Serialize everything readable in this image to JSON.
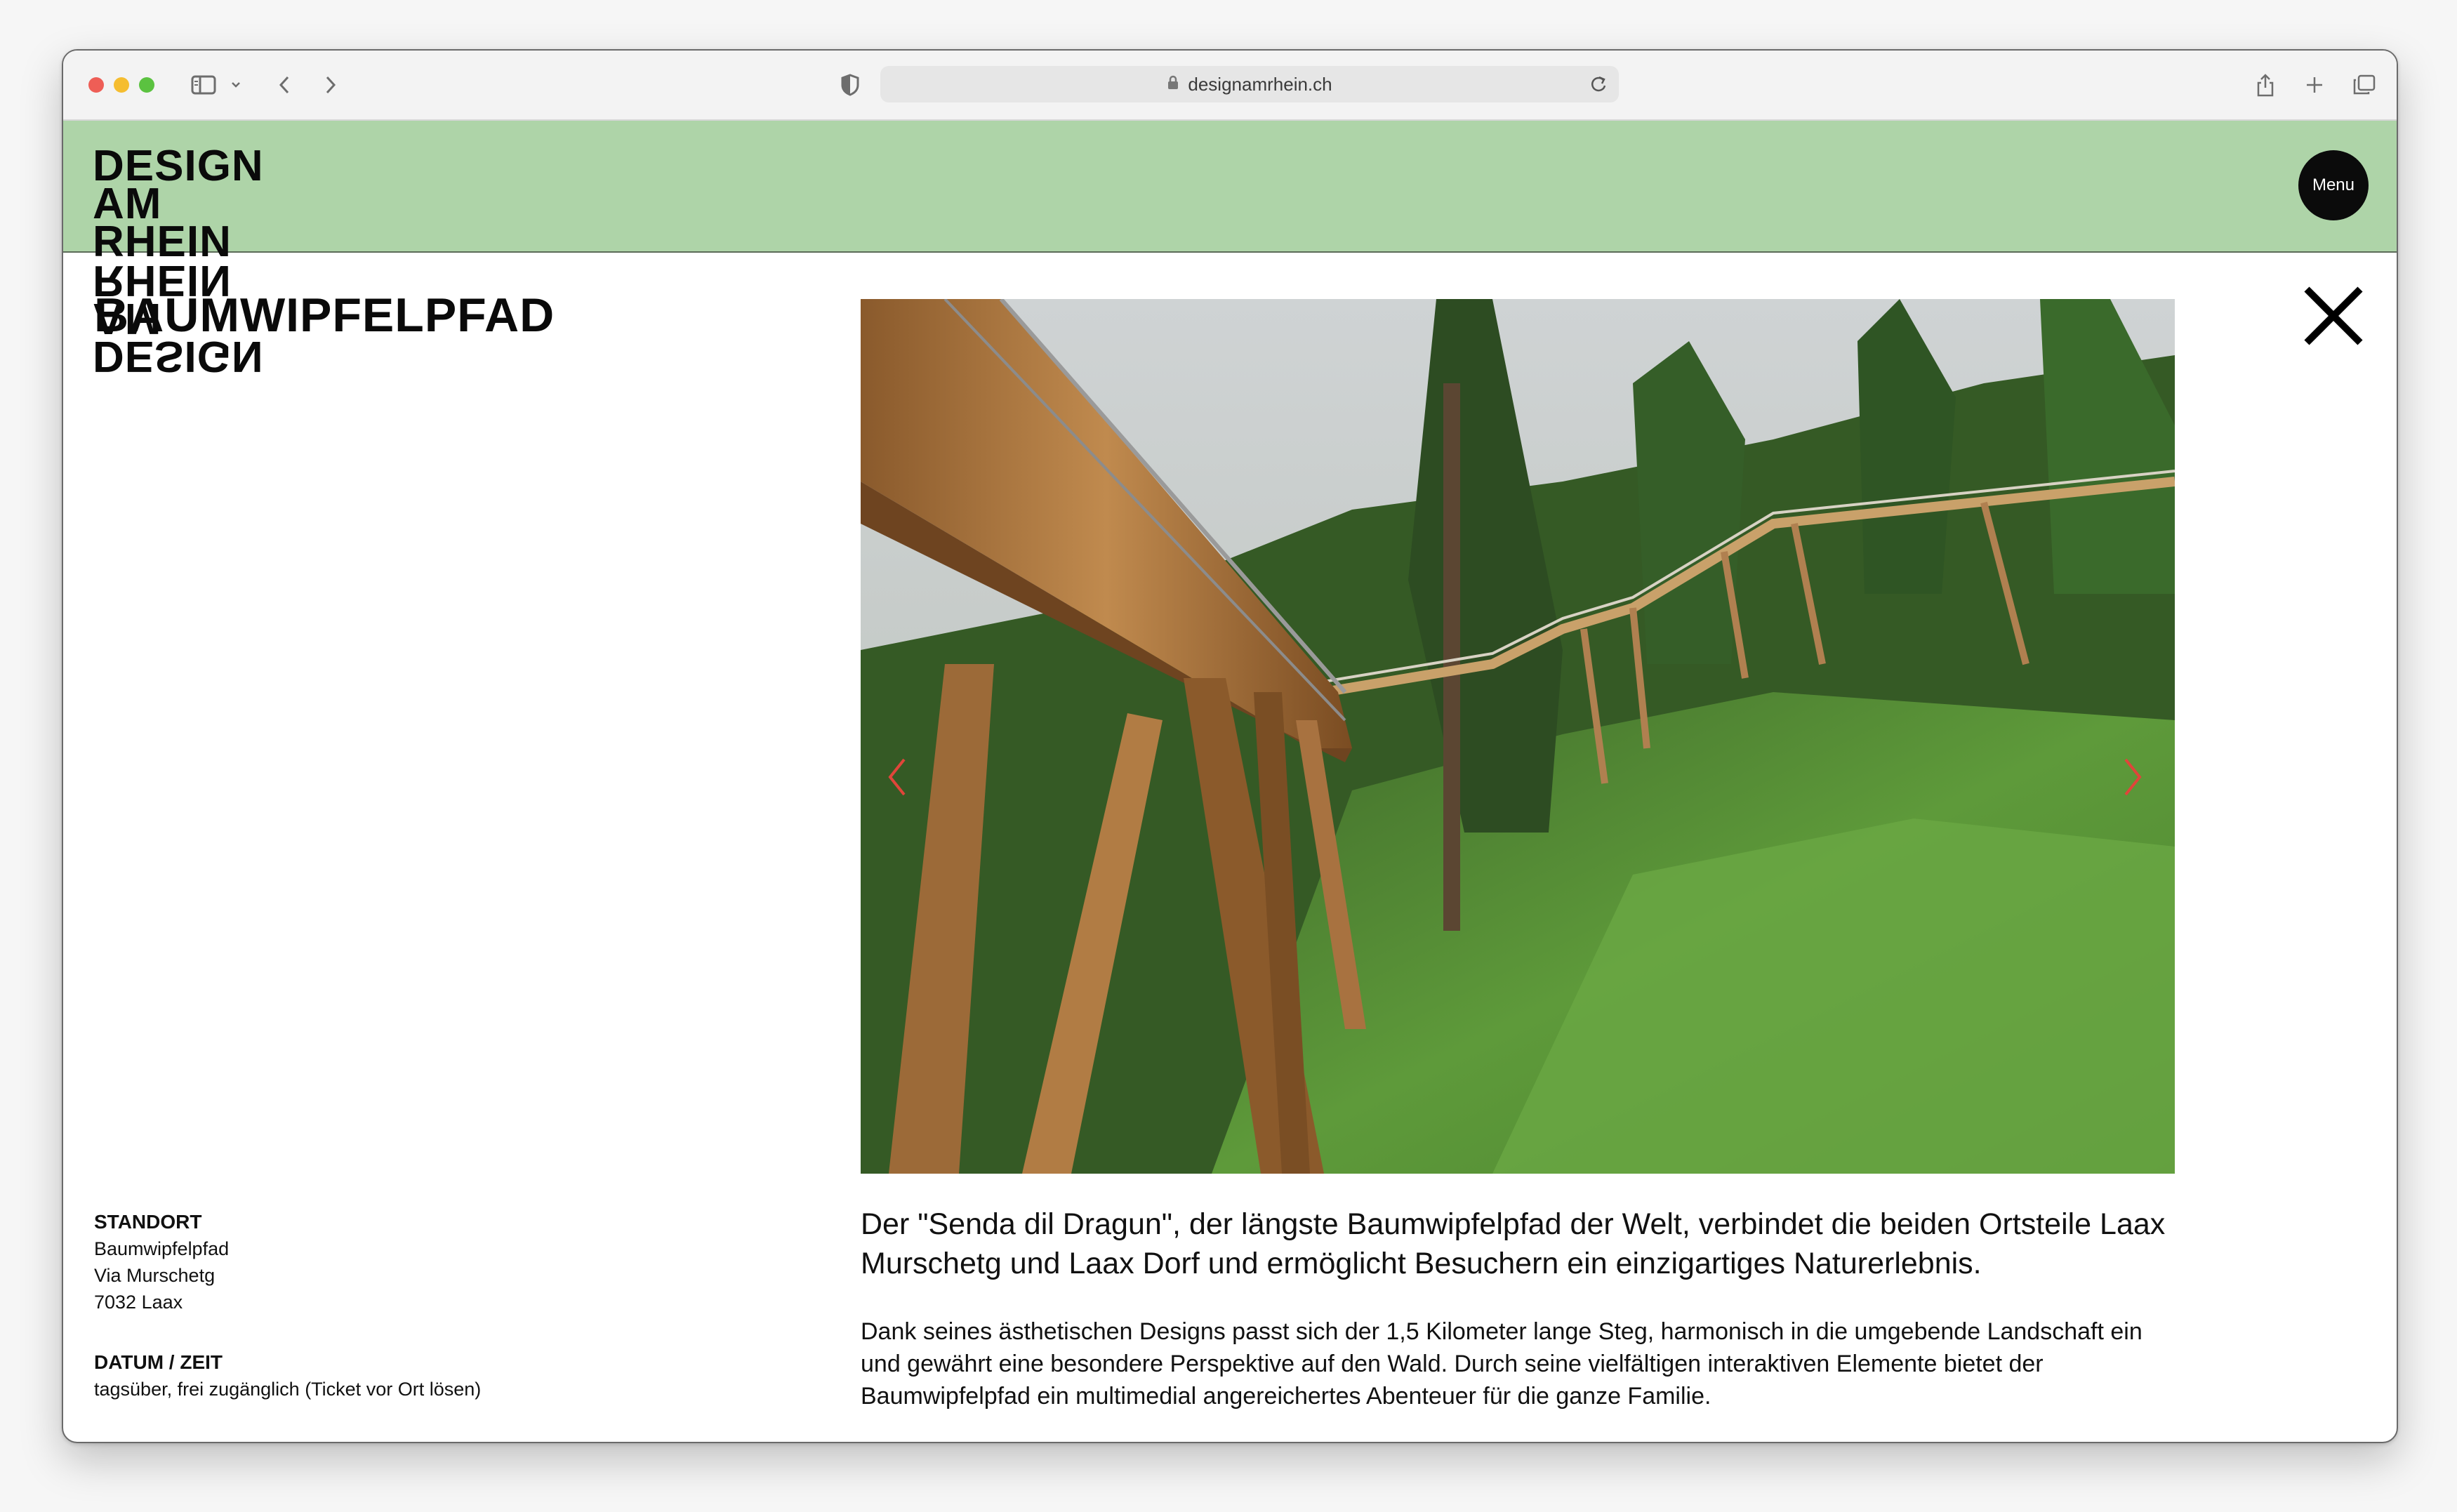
{
  "browser": {
    "url": "designamrhein.ch"
  },
  "site": {
    "logo_line1": "DESIGN AM RHEIN",
    "logo_line2": "DESIGN AM RHEIN",
    "menu_label": "Menu"
  },
  "page": {
    "title": "BAUMWIPFELPFAD",
    "lead": "Der \"Senda dil Dragun\", der längste Baumwipfelpfad der Welt, verbindet die beiden Ortsteile Laax Murschetg und Laax Dorf und ermöglicht Besuchern ein einzigartiges Naturerlebnis.",
    "body": "Dank seines ästhetischen Designs passt sich der 1,5 Kilometer lange Steg, harmonisch in die umgebende Landschaft ein und gewährt eine besondere Perspektive auf den Wald. Durch seine vielfältigen interaktiven Elemente bietet der Baumwipfelpfad ein multimedial angereichertes Abenteuer für die ganze Familie."
  },
  "standort": {
    "label": "STANDORT",
    "line1": "Baumwipfelpfad",
    "line2": "Via Murschetg",
    "line3": "7032 Laax"
  },
  "datum": {
    "label": "DATUM / ZEIT",
    "value": "tagsüber, frei zugänglich (Ticket vor Ort lösen)"
  },
  "colors": {
    "header_bg": "#aed4a8",
    "carousel_arrow": "#e0453a"
  },
  "icons": [
    "sidebar-icon",
    "chevron-down-icon",
    "back-icon",
    "forward-icon",
    "shield-icon",
    "lock-icon",
    "reload-icon",
    "share-icon",
    "new-tab-icon",
    "tabs-overview-icon",
    "close-icon",
    "arrow-left-icon",
    "arrow-right-icon"
  ]
}
